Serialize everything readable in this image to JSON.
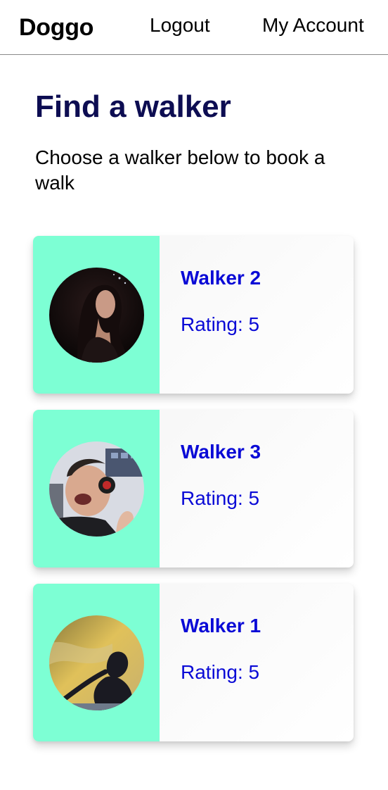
{
  "nav": {
    "brand": "Doggo",
    "logout": "Logout",
    "account": "My Account"
  },
  "main": {
    "title": "Find a walker",
    "subtitle": "Choose a walker below to book a walk"
  },
  "walkers": [
    {
      "name": "Walker 2",
      "rating": "Rating: 5",
      "avatar": "walker-2-avatar"
    },
    {
      "name": "Walker 3",
      "rating": "Rating: 5",
      "avatar": "walker-3-avatar"
    },
    {
      "name": "Walker 1",
      "rating": "Rating: 5",
      "avatar": "walker-1-avatar"
    }
  ],
  "colors": {
    "title": "#0d0d52",
    "walker_text": "#0a0ad6",
    "card_accent": "#7dffd4"
  }
}
